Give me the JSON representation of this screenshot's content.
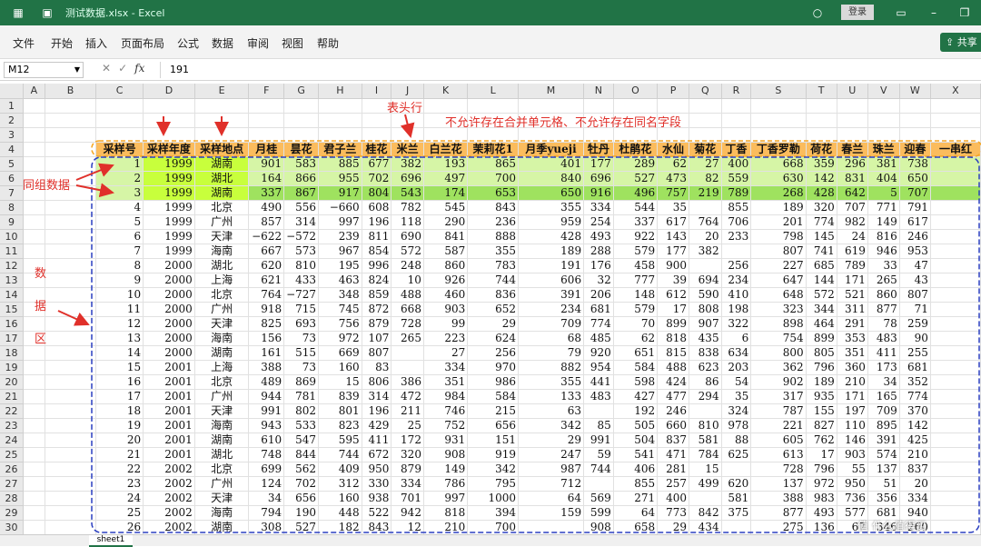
{
  "window": {
    "title": "测试数据.xlsx - Excel",
    "login": "登录"
  },
  "menu": {
    "items": [
      "文件",
      "开始",
      "插入",
      "页面布局",
      "公式",
      "数据",
      "审阅",
      "视图",
      "帮助"
    ],
    "share": "共享"
  },
  "formula_bar": {
    "name_box": "M12",
    "fx": "fx",
    "value": "191"
  },
  "columns": [
    "A",
    "B",
    "C",
    "D",
    "E",
    "F",
    "G",
    "H",
    "I",
    "J",
    "K",
    "L",
    "M",
    "N",
    "O",
    "P",
    "Q",
    "R",
    "S",
    "T",
    "U",
    "V",
    "W",
    "X"
  ],
  "headers": [
    "采样号",
    "采样年度",
    "采样地点",
    "月桂",
    "昙花",
    "君子兰",
    "桂花",
    "米兰",
    "白兰花",
    "茉莉花1",
    "月季yueji",
    "牡丹",
    "杜鹃花",
    "水仙",
    "菊花",
    "丁香",
    "丁香罗勒",
    "荷花",
    "春兰",
    "珠兰",
    "迎春",
    "一串红"
  ],
  "rows": [
    [
      "1",
      "1999",
      "湖南",
      "901",
      "583",
      "885",
      "677",
      "382",
      "193",
      "865",
      "401",
      "177",
      "289",
      "62",
      "27",
      "400",
      "668",
      "359",
      "296",
      "381",
      "738"
    ],
    [
      "2",
      "1999",
      "湖北",
      "164",
      "866",
      "955",
      "702",
      "696",
      "497",
      "700",
      "840",
      "696",
      "527",
      "473",
      "82",
      "559",
      "630",
      "142",
      "831",
      "404",
      "650"
    ],
    [
      "3",
      "1999",
      "湖南",
      "337",
      "867",
      "917",
      "804",
      "543",
      "174",
      "653",
      "650",
      "916",
      "496",
      "757",
      "219",
      "789",
      "268",
      "428",
      "642",
      "5",
      "707"
    ],
    [
      "4",
      "1999",
      "北京",
      "490",
      "556",
      "−660",
      "608",
      "782",
      "545",
      "843",
      "355",
      "334",
      "544",
      "35",
      "",
      "855",
      "189",
      "320",
      "707",
      "771",
      "791"
    ],
    [
      "5",
      "1999",
      "广州",
      "857",
      "314",
      "997",
      "196",
      "118",
      "290",
      "236",
      "959",
      "254",
      "337",
      "617",
      "764",
      "706",
      "201",
      "774",
      "982",
      "149",
      "617"
    ],
    [
      "6",
      "1999",
      "天津",
      "−622",
      "−572",
      "239",
      "811",
      "690",
      "841",
      "888",
      "428",
      "493",
      "922",
      "143",
      "20",
      "233",
      "798",
      "145",
      "24",
      "816",
      "246"
    ],
    [
      "7",
      "1999",
      "海南",
      "667",
      "573",
      "967",
      "854",
      "572",
      "587",
      "355",
      "189",
      "288",
      "579",
      "177",
      "382",
      "",
      "807",
      "741",
      "619",
      "946",
      "953"
    ],
    [
      "8",
      "2000",
      "湖北",
      "620",
      "810",
      "195",
      "996",
      "248",
      "860",
      "783",
      "191",
      "176",
      "458",
      "900",
      "",
      "256",
      "227",
      "685",
      "789",
      "33",
      "47"
    ],
    [
      "9",
      "2000",
      "上海",
      "621",
      "433",
      "463",
      "824",
      "10",
      "926",
      "744",
      "606",
      "32",
      "777",
      "39",
      "694",
      "234",
      "647",
      "144",
      "171",
      "265",
      "43"
    ],
    [
      "10",
      "2000",
      "北京",
      "764",
      "−727",
      "348",
      "859",
      "488",
      "460",
      "836",
      "391",
      "206",
      "148",
      "612",
      "590",
      "410",
      "648",
      "572",
      "521",
      "860",
      "807"
    ],
    [
      "11",
      "2000",
      "广州",
      "918",
      "715",
      "745",
      "872",
      "668",
      "903",
      "652",
      "234",
      "681",
      "579",
      "17",
      "808",
      "198",
      "323",
      "344",
      "311",
      "877",
      "71"
    ],
    [
      "12",
      "2000",
      "天津",
      "825",
      "693",
      "756",
      "879",
      "728",
      "99",
      "29",
      "709",
      "774",
      "70",
      "899",
      "907",
      "322",
      "898",
      "464",
      "291",
      "78",
      "259"
    ],
    [
      "13",
      "2000",
      "海南",
      "156",
      "73",
      "972",
      "107",
      "265",
      "223",
      "624",
      "68",
      "485",
      "62",
      "818",
      "435",
      "6",
      "754",
      "899",
      "353",
      "483",
      "90"
    ],
    [
      "14",
      "2000",
      "湖南",
      "161",
      "515",
      "669",
      "807",
      "",
      "27",
      "256",
      "79",
      "920",
      "651",
      "815",
      "838",
      "634",
      "800",
      "805",
      "351",
      "411",
      "255"
    ],
    [
      "15",
      "2001",
      "上海",
      "388",
      "73",
      "160",
      "83",
      "",
      "334",
      "970",
      "882",
      "954",
      "584",
      "488",
      "623",
      "203",
      "362",
      "796",
      "360",
      "173",
      "681"
    ],
    [
      "16",
      "2001",
      "北京",
      "489",
      "869",
      "15",
      "806",
      "386",
      "351",
      "986",
      "355",
      "441",
      "598",
      "424",
      "86",
      "54",
      "902",
      "189",
      "210",
      "34",
      "352"
    ],
    [
      "17",
      "2001",
      "广州",
      "944",
      "781",
      "839",
      "314",
      "472",
      "984",
      "584",
      "133",
      "483",
      "427",
      "477",
      "294",
      "35",
      "317",
      "935",
      "171",
      "165",
      "774"
    ],
    [
      "18",
      "2001",
      "天津",
      "991",
      "802",
      "801",
      "196",
      "211",
      "746",
      "215",
      "63",
      "",
      "192",
      "246",
      "",
      "324",
      "787",
      "155",
      "197",
      "709",
      "370"
    ],
    [
      "19",
      "2001",
      "海南",
      "943",
      "533",
      "823",
      "429",
      "25",
      "752",
      "656",
      "342",
      "85",
      "505",
      "660",
      "810",
      "978",
      "221",
      "827",
      "110",
      "895",
      "142"
    ],
    [
      "20",
      "2001",
      "湖南",
      "610",
      "547",
      "595",
      "411",
      "172",
      "931",
      "151",
      "29",
      "991",
      "504",
      "837",
      "581",
      "88",
      "605",
      "762",
      "146",
      "391",
      "425"
    ],
    [
      "21",
      "2001",
      "湖北",
      "748",
      "844",
      "744",
      "672",
      "320",
      "908",
      "919",
      "247",
      "59",
      "541",
      "471",
      "784",
      "625",
      "613",
      "17",
      "903",
      "574",
      "210"
    ],
    [
      "22",
      "2002",
      "北京",
      "699",
      "562",
      "409",
      "950",
      "879",
      "149",
      "342",
      "987",
      "744",
      "406",
      "281",
      "15",
      "",
      "728",
      "796",
      "55",
      "137",
      "837"
    ],
    [
      "23",
      "2002",
      "广州",
      "124",
      "702",
      "312",
      "330",
      "334",
      "786",
      "795",
      "712",
      "",
      "855",
      "257",
      "499",
      "620",
      "137",
      "972",
      "950",
      "51",
      "20"
    ],
    [
      "24",
      "2002",
      "天津",
      "34",
      "656",
      "160",
      "938",
      "701",
      "997",
      "1000",
      "64",
      "569",
      "271",
      "400",
      "",
      "581",
      "388",
      "983",
      "736",
      "356",
      "334"
    ],
    [
      "25",
      "2002",
      "海南",
      "794",
      "190",
      "448",
      "522",
      "942",
      "818",
      "394",
      "159",
      "599",
      "64",
      "773",
      "842",
      "375",
      "877",
      "493",
      "577",
      "681",
      "940"
    ],
    [
      "26",
      "2002",
      "湖南",
      "308",
      "527",
      "182",
      "843",
      "12",
      "210",
      "700",
      "",
      "908",
      "658",
      "29",
      "434",
      "",
      "275",
      "136",
      "67",
      "346",
      "260"
    ]
  ],
  "annotations": {
    "header_row": "表头行",
    "rule": "不允许存在合并单元格、不允许存在同名字段",
    "group": "同组数据",
    "data_area": [
      "数",
      "据",
      "区"
    ]
  },
  "sheet_tab": "sheet1",
  "watermark": "值 什么值得买"
}
